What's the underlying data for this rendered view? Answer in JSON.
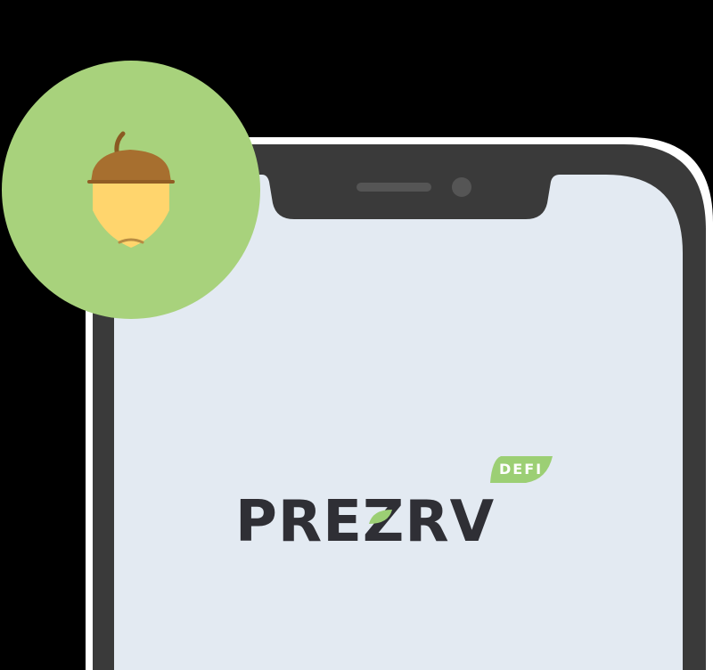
{
  "app": {
    "brand_name": "PREZRV",
    "brand_tag": "DEFI"
  },
  "icons": {
    "badge_icon": "acorn-icon",
    "logo_leaf": "leaf-icon",
    "camera": "front-camera-icon",
    "speaker": "earpiece-speaker-icon"
  },
  "colors": {
    "background": "#000000",
    "phone_outline": "#ffffff",
    "phone_frame": "#3a3a3a",
    "screen": "#e3eaf2",
    "badge_circle": "#a8d27c",
    "acorn_cap": "#a76f2f",
    "acorn_nut": "#ffd56d",
    "wordmark": "#2f2f35",
    "accent_green": "#9ccf74"
  }
}
